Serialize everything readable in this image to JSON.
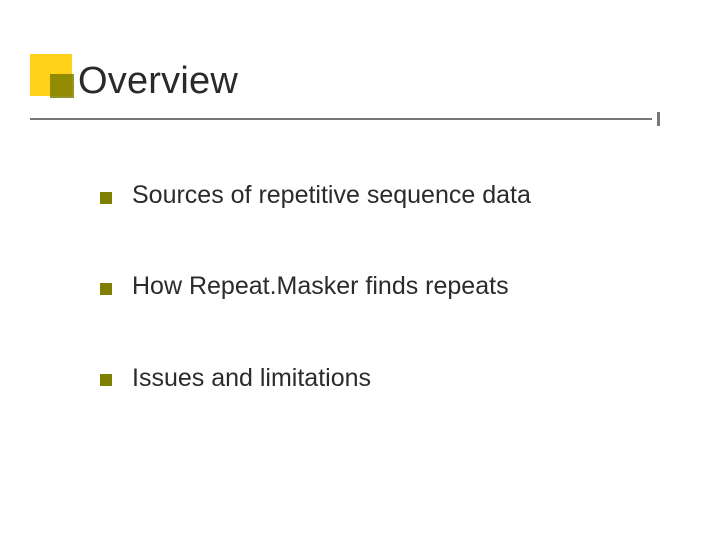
{
  "slide": {
    "title": "Overview",
    "bullets": [
      {
        "text": "Sources of repetitive sequence data"
      },
      {
        "text": "How Repeat.Masker finds repeats"
      },
      {
        "text": "Issues and limitations"
      }
    ],
    "colors": {
      "accent_outer": "#ffcc00",
      "accent_inner": "#808000",
      "bullet": "#808000",
      "divider": "#777777"
    }
  }
}
